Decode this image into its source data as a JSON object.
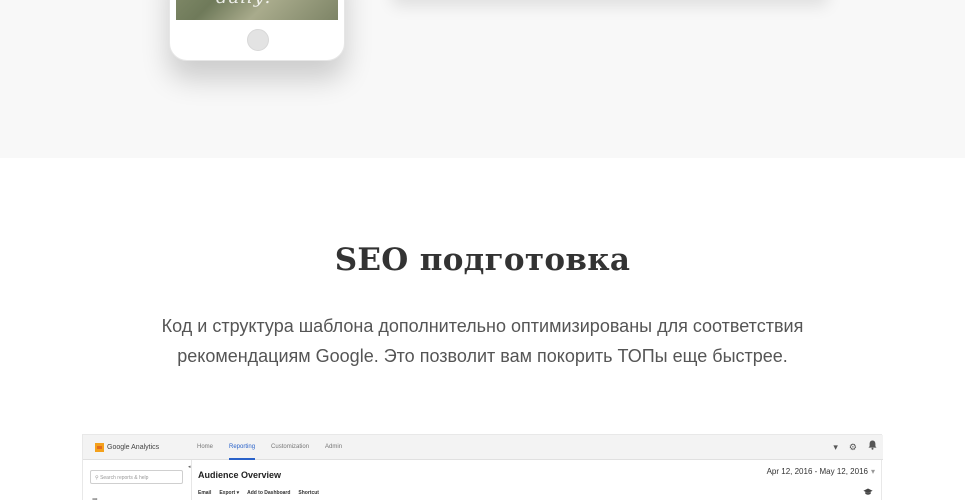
{
  "hero": {
    "phone_image_text": "daily!"
  },
  "section": {
    "title": "SEO подготовка",
    "text": "Код и структура шаблона дополнительно оптимизированы для соответствия рекомендациям Google. Это позволит вам покорить ТОПы еще быстрее."
  },
  "analytics": {
    "logo_text": "Google Analytics",
    "nav": [
      "Home",
      "Reporting",
      "Customization",
      "Admin"
    ],
    "active_nav": "Reporting",
    "icons": [
      "caret-down-icon",
      "gear-icon",
      "bell-icon"
    ],
    "search_placeholder": "Search reports & help",
    "collapse_glyph": "◂",
    "sidebar_glyph": "▦",
    "page_title": "Audience Overview",
    "date_range": "Apr 12, 2016 - May 12, 2016",
    "toolbar": [
      "Email",
      "Export ▾",
      "Add to Dashboard",
      "Shortcut"
    ],
    "cap_icon": "graduation-cap-icon"
  },
  "colors": {
    "band": "#f8f8f8",
    "accent": "#2a62c9",
    "logo": "#f4a11c"
  }
}
